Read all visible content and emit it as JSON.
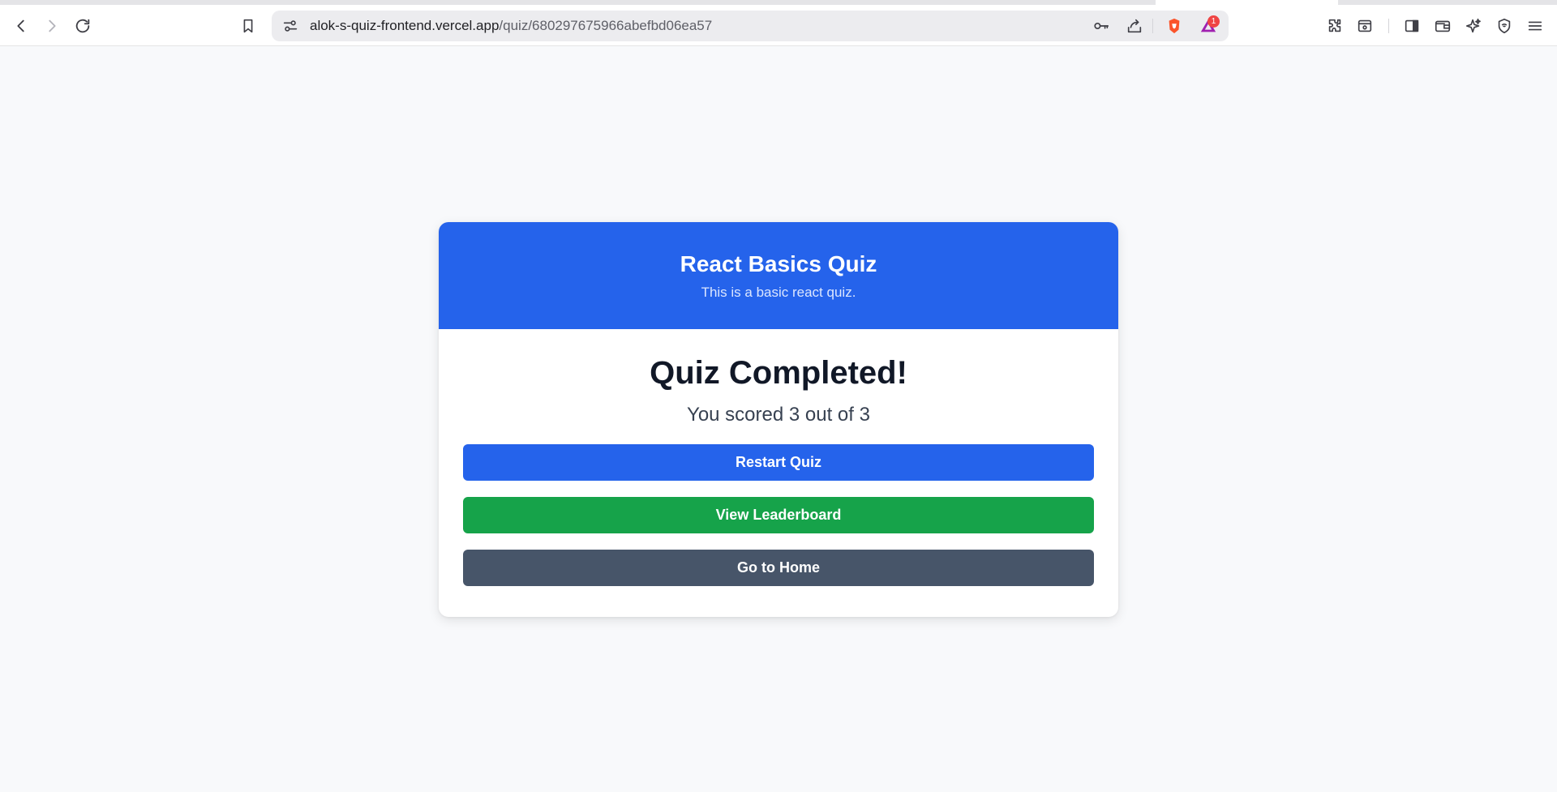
{
  "browser": {
    "url_host": "alok-s-quiz-frontend.vercel.app",
    "url_path": "/quiz/680297675966abefbd06ea57",
    "rewards_badge_count": "1",
    "icons": [
      "back-icon",
      "forward-icon",
      "reload-icon",
      "bookmark-icon",
      "site-settings-icon",
      "key-icon",
      "share-icon",
      "brave-shields-icon",
      "brave-rewards-icon",
      "extensions-icon",
      "screenshot-icon",
      "sidebar-icon",
      "wallet-icon",
      "leo-ai-icon",
      "vpn-icon",
      "menu-icon"
    ]
  },
  "quiz": {
    "title": "React Basics Quiz",
    "description": "This is a basic react quiz.",
    "completed_title": "Quiz Completed!",
    "score_text": "You scored 3 out of 3",
    "score": 3,
    "total": 3
  },
  "actions": {
    "restart_label": "Restart Quiz",
    "leaderboard_label": "View Leaderboard",
    "home_label": "Go to Home"
  },
  "colors": {
    "header_bg": "#2563eb",
    "restart_bg": "#2563eb",
    "leaderboard_bg": "#16a34a",
    "home_bg": "#475569",
    "page_bg": "#f8f9fb"
  }
}
